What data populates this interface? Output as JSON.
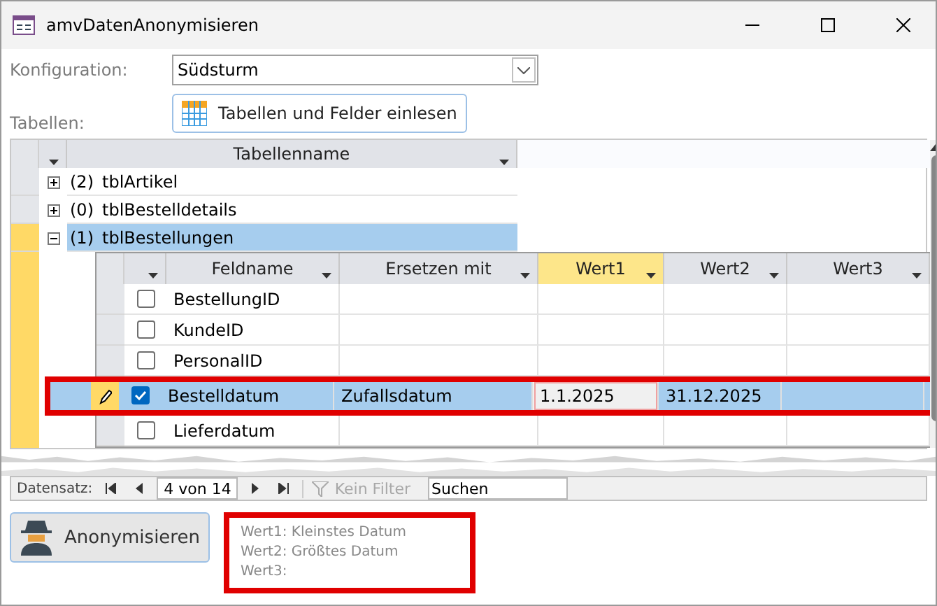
{
  "window": {
    "title": "amvDatenAnonymisieren"
  },
  "config": {
    "label": "Konfiguration:",
    "value": "Südsturm"
  },
  "load_button": {
    "label": "Tabellen und Felder einlesen"
  },
  "tables_label": "Tabellen:",
  "datasheet": {
    "column": "Tabellenname",
    "rows": [
      {
        "count": "(2)",
        "name": "tblArtikel",
        "expanded": false,
        "selected": false
      },
      {
        "count": "(0)",
        "name": "tblBestelldetails",
        "expanded": false,
        "selected": false
      },
      {
        "count": "(1)",
        "name": "tblBestellungen",
        "expanded": true,
        "selected": true
      }
    ],
    "subdatasheet": {
      "columns": [
        {
          "label": "Feldname",
          "selected": false
        },
        {
          "label": "Ersetzen mit",
          "selected": false
        },
        {
          "label": "Wert1",
          "selected": true
        },
        {
          "label": "Wert2",
          "selected": false
        },
        {
          "label": "Wert3",
          "selected": false
        }
      ],
      "rows": [
        {
          "checked": false,
          "selected": false,
          "highlighted": false,
          "cells": [
            "BestellungID"
          ]
        },
        {
          "checked": false,
          "selected": false,
          "highlighted": false,
          "cells": [
            "KundeID"
          ]
        },
        {
          "checked": false,
          "selected": false,
          "highlighted": false,
          "cells": [
            "PersonalID"
          ]
        },
        {
          "checked": true,
          "selected": true,
          "highlighted": true,
          "cells": [
            "Bestelldatum",
            "Zufallsdatum",
            "1.1.2025",
            "31.12.2025"
          ]
        },
        {
          "checked": false,
          "selected": false,
          "highlighted": false,
          "cells": [
            "Lieferdatum"
          ]
        }
      ]
    }
  },
  "navigation": {
    "label": "Datensatz:",
    "position": "4 von 14",
    "filter": "Kein Filter",
    "search": {
      "placeholder": "Suchen"
    }
  },
  "action_button": {
    "label": "Anonymisieren"
  },
  "hint": {
    "lines": [
      "Wert1: Kleinstes Datum",
      "Wert2: Größtes Datum",
      "Wert3:"
    ]
  }
}
